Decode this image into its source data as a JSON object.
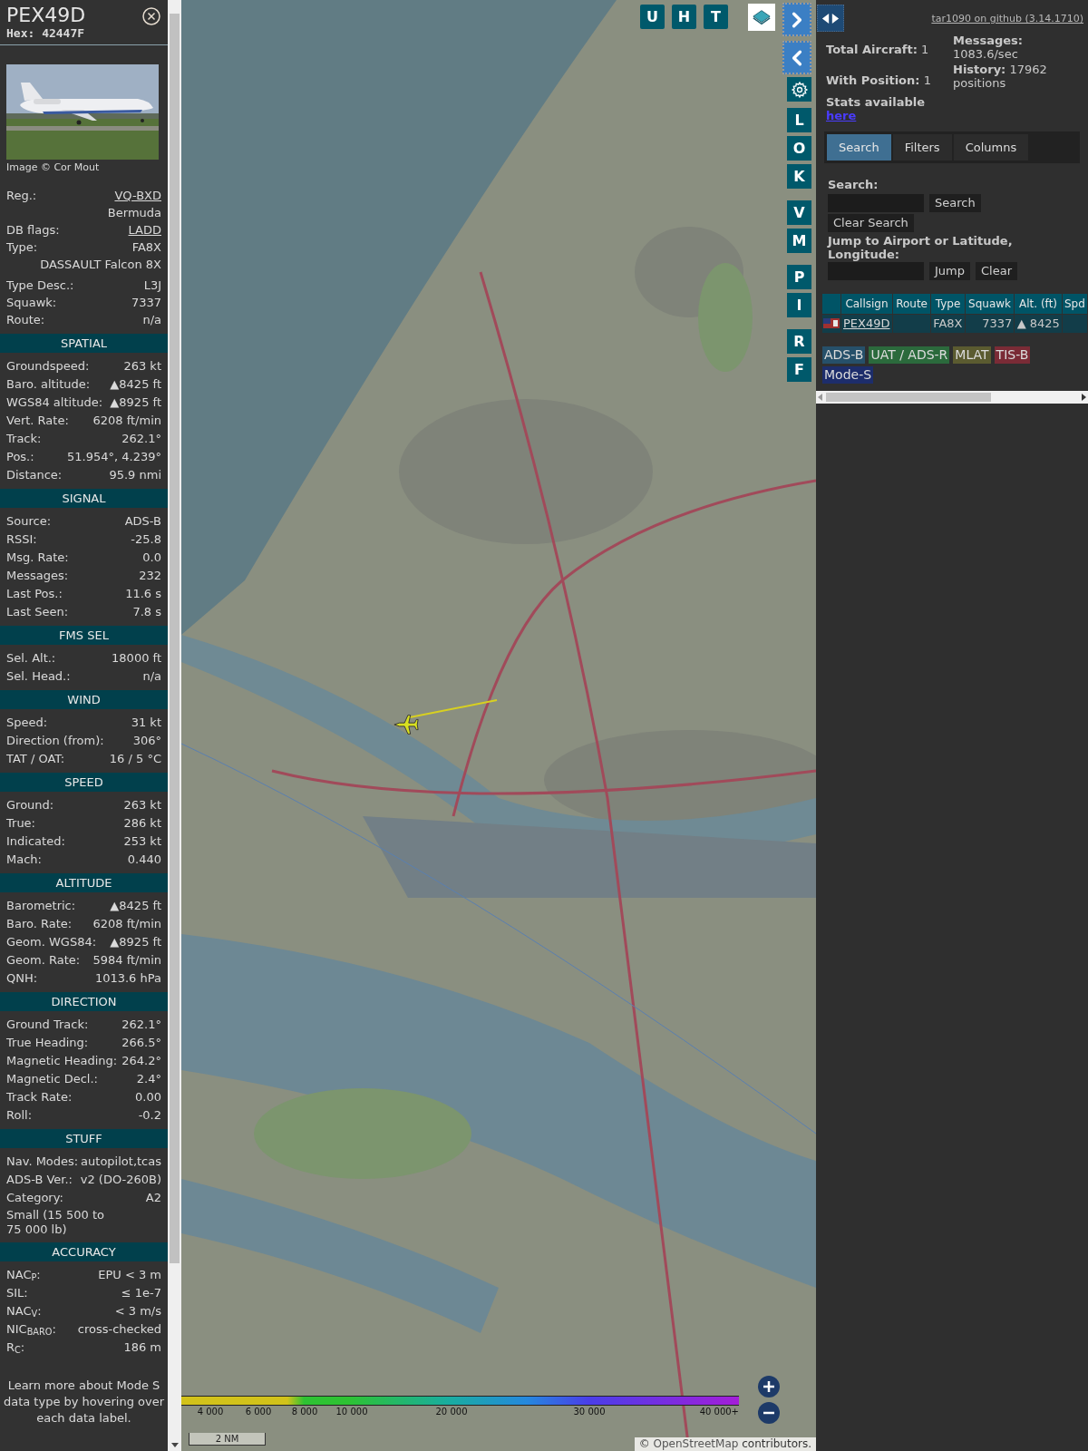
{
  "sidebar": {
    "title": "PEX49D",
    "hex": "Hex: 42447F",
    "photo_credit": "Image © Cor Mout",
    "info": [
      {
        "kind": "pair",
        "label": "Reg.:",
        "value": "VQ-BXD",
        "link": true
      },
      {
        "kind": "value_only",
        "value": "Bermuda",
        "link": false
      },
      {
        "kind": "pair",
        "label": "DB flags:",
        "value": "LADD",
        "link": true
      },
      {
        "kind": "pair",
        "label": "Type:",
        "value": "FA8X",
        "link": false
      },
      {
        "kind": "value_only",
        "value": "DASSAULT Falcon 8X",
        "link": false
      },
      {
        "kind": "pair",
        "label": "Type Desc.:",
        "value": "L3J",
        "link": false
      },
      {
        "kind": "pair",
        "label": "Squawk:",
        "value": "7337",
        "link": false
      },
      {
        "kind": "pair",
        "label": "Route:",
        "value": "n/a",
        "link": false
      }
    ],
    "sections": [
      {
        "title": "SPATIAL",
        "rows": [
          {
            "label": "Groundspeed:",
            "value": "263 kt"
          },
          {
            "label": "Baro. altitude:",
            "value": "▲8425 ft"
          },
          {
            "label": "WGS84 altitude:",
            "value": "▲8925 ft"
          },
          {
            "label": "Vert. Rate:",
            "value": "6208 ft/min"
          },
          {
            "label": "Track:",
            "value": "262.1°"
          },
          {
            "label": "Pos.:",
            "value": "51.954°, 4.239°"
          },
          {
            "label": "Distance:",
            "value": "95.9 nmi"
          }
        ]
      },
      {
        "title": "SIGNAL",
        "rows": [
          {
            "label": "Source:",
            "value": "ADS-B"
          },
          {
            "label": "RSSI:",
            "value": "-25.8"
          },
          {
            "label": "Msg. Rate:",
            "value": "0.0"
          },
          {
            "label": "Messages:",
            "value": "232"
          },
          {
            "label": "Last Pos.:",
            "value": "11.6 s"
          },
          {
            "label": "Last Seen:",
            "value": "7.8 s"
          }
        ]
      },
      {
        "title": "FMS SEL",
        "rows": [
          {
            "label": "Sel. Alt.:",
            "value": "18000 ft"
          },
          {
            "label": "Sel. Head.:",
            "value": "n/a"
          }
        ]
      },
      {
        "title": "WIND",
        "rows": [
          {
            "label": "Speed:",
            "value": "31 kt"
          },
          {
            "label": "Direction (from):",
            "value": "306°"
          },
          {
            "label": "TAT / OAT:",
            "value": "16 / 5 °C"
          }
        ]
      },
      {
        "title": "SPEED",
        "rows": [
          {
            "label": "Ground:",
            "value": "263 kt"
          },
          {
            "label": "True:",
            "value": "286 kt"
          },
          {
            "label": "Indicated:",
            "value": "253 kt"
          },
          {
            "label": "Mach:",
            "value": "0.440"
          }
        ]
      },
      {
        "title": "ALTITUDE",
        "rows": [
          {
            "label": "Barometric:",
            "value": "▲8425 ft"
          },
          {
            "label": "Baro. Rate:",
            "value": "6208 ft/min"
          },
          {
            "label": "Geom. WGS84:",
            "value": "▲8925 ft"
          },
          {
            "label": "Geom. Rate:",
            "value": "5984 ft/min"
          },
          {
            "label": "QNH:",
            "value": "1013.6 hPa"
          }
        ]
      },
      {
        "title": "DIRECTION",
        "rows": [
          {
            "label": "Ground Track:",
            "value": "262.1°"
          },
          {
            "label": "True Heading:",
            "value": "266.5°"
          },
          {
            "label": "Magnetic Heading:",
            "value": "264.2°"
          },
          {
            "label": "Magnetic Decl.:",
            "value": "2.4°"
          },
          {
            "label": "Track Rate:",
            "value": "0.00"
          },
          {
            "label": "Roll:",
            "value": "-0.2"
          }
        ]
      },
      {
        "title": "STUFF",
        "rows": [
          {
            "kind": "pair",
            "label": "Nav. Modes:",
            "value": "autopilot,tcas"
          },
          {
            "kind": "pair",
            "label": "ADS-B Ver.:",
            "value": "v2 (DO-260B)"
          },
          {
            "kind": "pair",
            "label": "Category:",
            "value": "A2"
          },
          {
            "kind": "note",
            "value": "Small (15 500 to 75 000 lb)"
          }
        ]
      },
      {
        "title": "ACCURACY",
        "rows": [
          {
            "label": "NAC$_{P}$:",
            "value": "EPU < 3 m"
          },
          {
            "label": "SIL:",
            "value": "≤ 1e-7"
          },
          {
            "label": "NAC$_{V}$:",
            "value": "< 3 m/s"
          },
          {
            "label": "NIC$_{BARO}$:",
            "value": "cross-checked"
          },
          {
            "label": "R$_{C}$:",
            "value": "186 m"
          }
        ]
      }
    ],
    "footer": "Learn more about Mode S data type by hovering over each data label."
  },
  "map": {
    "top_buttons": [
      "U",
      "H",
      "T"
    ],
    "side_button_groups": [
      [
        "L",
        "O",
        "K"
      ],
      [
        "V",
        "M"
      ],
      [
        "P",
        "I"
      ],
      [
        "R",
        "F"
      ]
    ],
    "altitude_legend": [
      "4 000",
      "6 000",
      "8 000",
      "10 000",
      "20 000",
      "30 000",
      "40 000+"
    ],
    "scale": "2 NM",
    "attribution": {
      "prefix": "©",
      "link": "OpenStreetMap",
      "suffix": "contributors."
    }
  },
  "panel": {
    "github_link": "tar1090 on github (3.14.1710)",
    "stats": [
      "**Total Aircraft:** 1",
      "**With Position:** 1",
      "**Messages:** 1083.6/sec",
      "**History:** 17962 positions"
    ],
    "stats_link_label": "Stats available",
    "stats_link": "here",
    "tabs": [
      {
        "label": "Search",
        "selected": true
      },
      {
        "label": "Filters",
        "selected": false
      },
      {
        "label": "Columns",
        "selected": false
      }
    ],
    "search_label": "Search:",
    "search_buttons": [
      "Search",
      "Clear Search"
    ],
    "jump_label": "Jump to Airport or Latitude, Longitude:",
    "jump_buttons": [
      "Jump",
      "Clear"
    ],
    "table": {
      "columns": [
        "Callsign",
        "Route",
        "Type",
        "Squawk",
        "Alt. (ft)",
        "Spd"
      ],
      "rows": [
        {
          "callsign": "PEX49D",
          "type": "FA8X",
          "squawk": "7337",
          "altitude": "▲ 8425"
        }
      ]
    },
    "sources": [
      {
        "label": "ADS-B",
        "color": "#26506a"
      },
      {
        "label": "UAT / ADS-R",
        "color": "#2b6a3c"
      },
      {
        "label": "MLAT",
        "color": "#5b5b30"
      },
      {
        "label": "TIS-B",
        "color": "#7a2b36"
      },
      {
        "label": "Mode-S",
        "color": "#1d2d6b"
      }
    ]
  }
}
